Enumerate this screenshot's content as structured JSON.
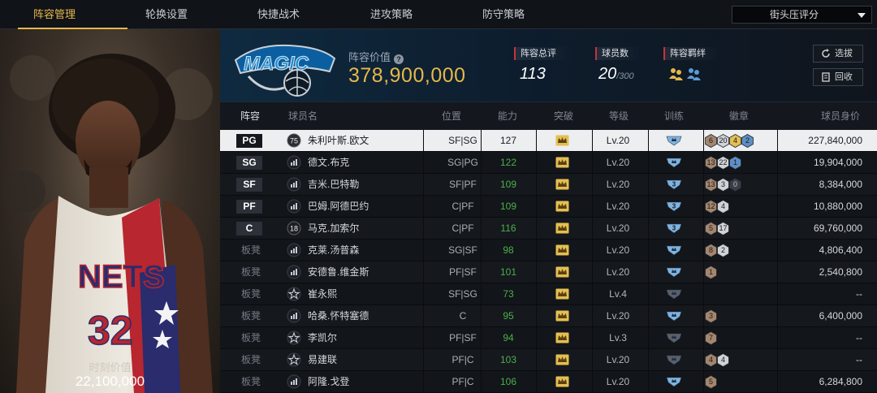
{
  "nav": {
    "tabs": [
      "阵容管理",
      "轮换设置",
      "快捷战术",
      "进攻策略",
      "防守策略"
    ],
    "active_index": 0,
    "sort_select": "街头压评分"
  },
  "portrait": {
    "jersey_team": "NETS",
    "jersey_number": "32",
    "caption_label": "时刻价值",
    "caption_value": "22,100,000"
  },
  "header": {
    "team_logo_text": "MAGIC",
    "lineup_value_label": "阵容价值",
    "lineup_value": "378,900,000",
    "overall_label": "阵容总评",
    "overall_value": "113",
    "players_label": "球员数",
    "players_value": "20",
    "players_max": "/300",
    "bond_label": "阵容羁绊",
    "btn_select": "选拔",
    "btn_recycle": "回收"
  },
  "columns": [
    "阵容",
    "球员名",
    "位置",
    "能力",
    "突破",
    "等级",
    "训练",
    "徽章",
    "球员身价"
  ],
  "colors": {
    "accent_gold": "#e6b84a",
    "rating_green": "#4cb04c",
    "selected_row": "#eceef0",
    "badge_bronze": "#a4866e",
    "badge_silver": "#cfd3d8",
    "badge_gold": "#e3bf52",
    "badge_blue": "#5d8fc4",
    "badge_dark": "#3a3f47"
  },
  "rows": [
    {
      "slot": "PG",
      "icon": "75",
      "name": "朱利叶斯.欧文",
      "position": "SF|SG",
      "rating": "127",
      "level": "Lv.20",
      "train": "blue",
      "training_level": "",
      "badges": [
        {
          "c": "bronze",
          "t": "6"
        },
        {
          "c": "silver",
          "t": "20"
        },
        {
          "c": "gold",
          "t": "4"
        },
        {
          "c": "blue",
          "t": "2"
        }
      ],
      "value": "227,840,000",
      "selected": true
    },
    {
      "slot": "SG",
      "icon": "bars",
      "name": "德文.布克",
      "position": "SG|PG",
      "rating": "122",
      "level": "Lv.20",
      "train": "blue",
      "training_level": "",
      "badges": [
        {
          "c": "bronze",
          "t": "13"
        },
        {
          "c": "silver",
          "t": "22"
        },
        {
          "c": "blue",
          "t": "1"
        }
      ],
      "value": "19,904,000"
    },
    {
      "slot": "SF",
      "icon": "bars",
      "name": "吉米.巴特勒",
      "position": "SF|PF",
      "rating": "109",
      "level": "Lv.20",
      "train": "blue3",
      "training_level": "3",
      "badges": [
        {
          "c": "bronze",
          "t": "13"
        },
        {
          "c": "silver",
          "t": "3"
        },
        {
          "c": "dark",
          "t": "0"
        }
      ],
      "value": "8,384,000"
    },
    {
      "slot": "PF",
      "icon": "bars",
      "name": "巴姆.阿德巴约",
      "position": "C|PF",
      "rating": "109",
      "level": "Lv.20",
      "train": "blue3",
      "training_level": "3",
      "badges": [
        {
          "c": "bronze",
          "t": "12"
        },
        {
          "c": "silver",
          "t": "4"
        }
      ],
      "value": "10,880,000"
    },
    {
      "slot": "C",
      "icon": "18",
      "name": "马克.加索尔",
      "position": "C|PF",
      "rating": "116",
      "level": "Lv.20",
      "train": "blue3",
      "training_level": "3",
      "badges": [
        {
          "c": "bronze",
          "t": "5"
        },
        {
          "c": "silver",
          "t": "17"
        }
      ],
      "value": "69,760,000"
    },
    {
      "slot": "板凳",
      "icon": "bars",
      "name": "克莱.汤普森",
      "position": "SG|SF",
      "rating": "98",
      "level": "Lv.20",
      "train": "blue",
      "training_level": "",
      "badges": [
        {
          "c": "bronze",
          "t": "8"
        },
        {
          "c": "silver",
          "t": "2"
        }
      ],
      "value": "4,806,400"
    },
    {
      "slot": "板凳",
      "icon": "bars",
      "name": "安德鲁.维金斯",
      "position": "PF|SF",
      "rating": "101",
      "level": "Lv.20",
      "train": "blue",
      "training_level": "",
      "badges": [
        {
          "c": "bronze",
          "t": "1"
        }
      ],
      "value": "2,540,800"
    },
    {
      "slot": "板凳",
      "icon": "star",
      "name": "崔永熙",
      "position": "SF|SG",
      "rating": "73",
      "level": "Lv.4",
      "train": "dark",
      "training_level": "",
      "badges": [],
      "value": "--"
    },
    {
      "slot": "板凳",
      "icon": "bars",
      "name": "哈桑.怀特塞德",
      "position": "C",
      "rating": "95",
      "level": "Lv.20",
      "train": "blue",
      "training_level": "",
      "badges": [
        {
          "c": "bronze",
          "t": "3"
        }
      ],
      "value": "6,400,000"
    },
    {
      "slot": "板凳",
      "icon": "star",
      "name": "李凯尔",
      "position": "PF|SF",
      "rating": "94",
      "level": "Lv.3",
      "train": "dark",
      "training_level": "",
      "badges": [
        {
          "c": "bronze",
          "t": "7"
        }
      ],
      "value": "--"
    },
    {
      "slot": "板凳",
      "icon": "star",
      "name": "易建联",
      "position": "PF|C",
      "rating": "103",
      "level": "Lv.20",
      "train": "dark",
      "training_level": "",
      "badges": [
        {
          "c": "bronze",
          "t": "4"
        },
        {
          "c": "silver",
          "t": "4"
        }
      ],
      "value": "--"
    },
    {
      "slot": "板凳",
      "icon": "bars",
      "name": "阿隆.戈登",
      "position": "PF|C",
      "rating": "106",
      "level": "Lv.20",
      "train": "blue",
      "training_level": "",
      "badges": [
        {
          "c": "bronze",
          "t": "5"
        }
      ],
      "value": "6,284,800"
    }
  ]
}
